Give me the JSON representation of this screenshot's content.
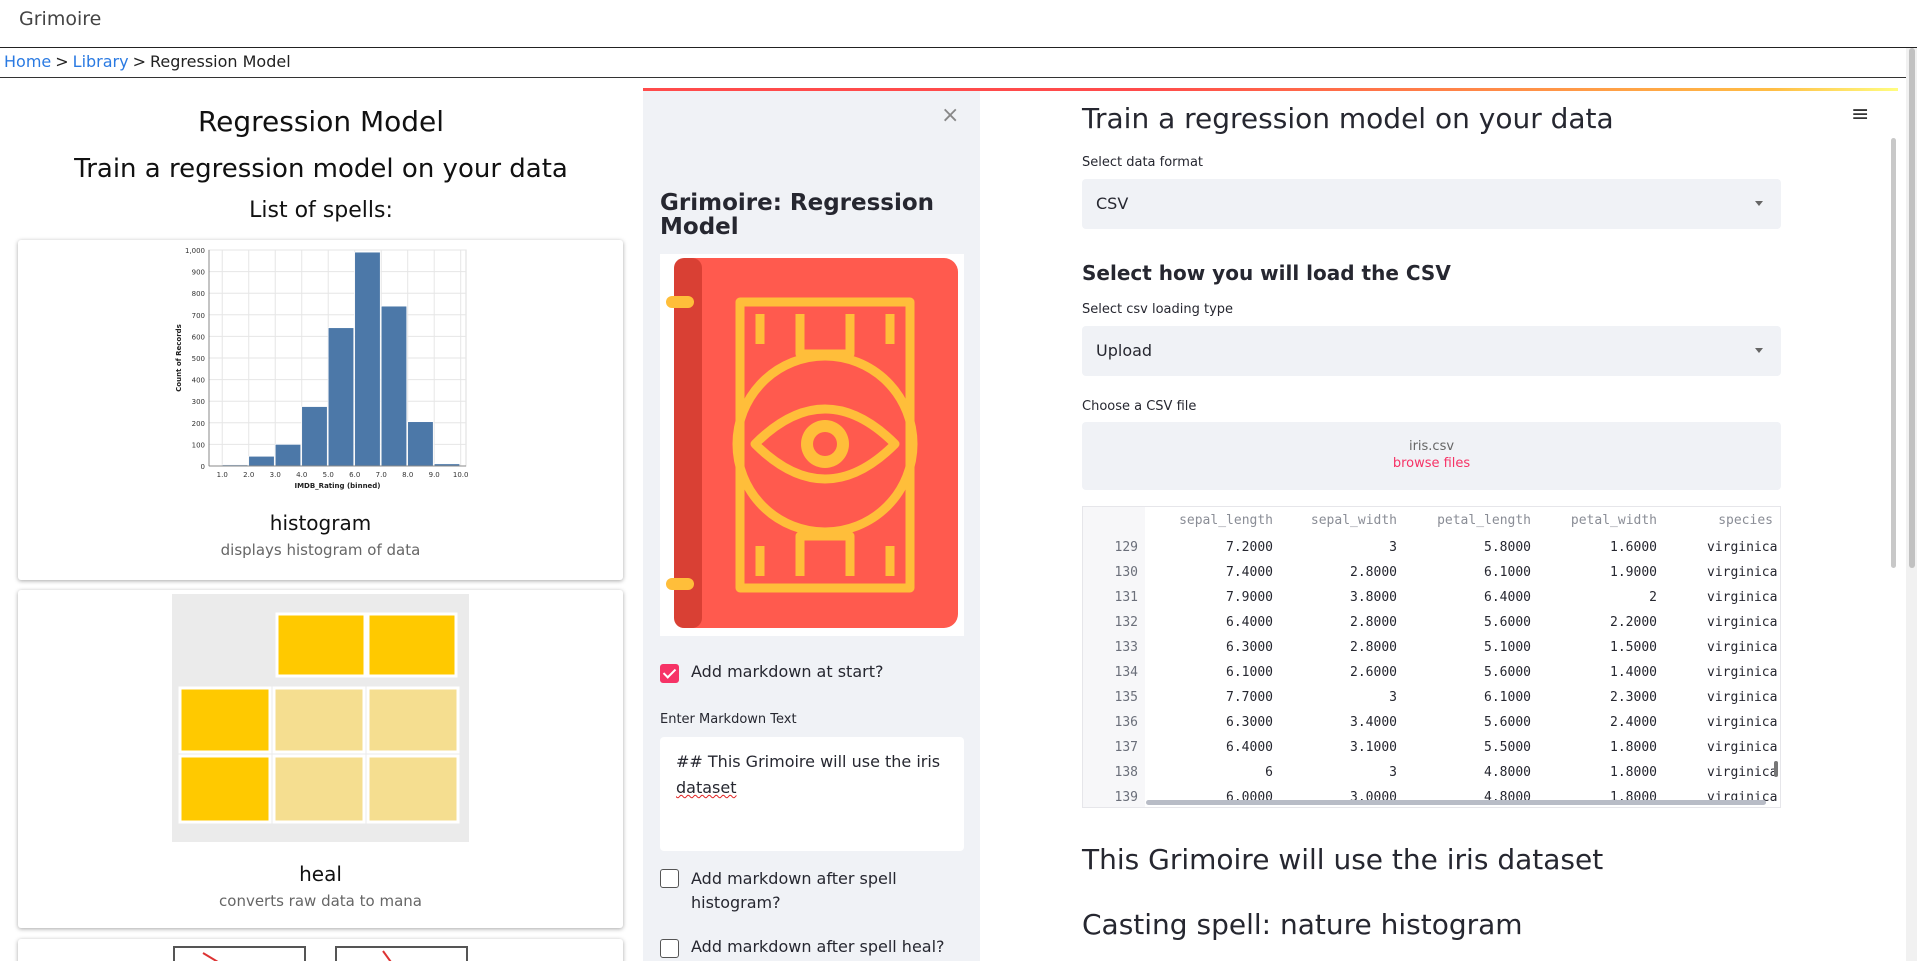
{
  "app": {
    "title": "Grimoire"
  },
  "breadcrumb": {
    "home": "Home",
    "library": "Library",
    "current": "Regression Model",
    "separator": ">"
  },
  "left": {
    "title": "Regression Model",
    "subtitle": "Train a regression model on your data",
    "list_heading": "List of spells:",
    "spells": [
      {
        "name": "histogram",
        "desc": "displays histogram of data"
      },
      {
        "name": "heal",
        "desc": "converts raw data to mana"
      }
    ]
  },
  "chart_data": {
    "type": "bar",
    "xlabel": "IMDB_Rating (binned)",
    "ylabel": "Count of Records",
    "x_ticks": [
      "1.0",
      "2.0",
      "3.0",
      "4.0",
      "5.0",
      "6.0",
      "7.0",
      "8.0",
      "9.0",
      "10.0"
    ],
    "y_ticks": [
      "0",
      "100",
      "200",
      "300",
      "400",
      "500",
      "600",
      "700",
      "800",
      "900",
      "1,000"
    ],
    "ylim": [
      0,
      1000
    ],
    "bins": [
      [
        1,
        2
      ],
      [
        2,
        3
      ],
      [
        3,
        4
      ],
      [
        4,
        5
      ],
      [
        5,
        6
      ],
      [
        6,
        7
      ],
      [
        7,
        8
      ],
      [
        8,
        9
      ],
      [
        9,
        10
      ]
    ],
    "values": [
      5,
      45,
      100,
      275,
      640,
      990,
      740,
      205,
      10
    ],
    "color": "#4c78a8"
  },
  "sidebar": {
    "close": "×",
    "title": "Grimoire: Regression Model",
    "add_start_label": "Add markdown at start?",
    "add_start_checked": true,
    "markdown_label": "Enter Markdown Text",
    "markdown_text_1": "## This Grimoire will use the iris",
    "markdown_text_2": "dataset",
    "after_histogram_label_1": "Add markdown after spell",
    "after_histogram_label_2": "histogram?",
    "after_heal_label": "Add markdown after spell heal?"
  },
  "main": {
    "title": "Train a regression model on your data",
    "menu_icon": "≡",
    "format_label": "Select data format",
    "format_value": "CSV",
    "load_heading": "Select how you will load the CSV",
    "loading_label": "Select csv loading type",
    "loading_value": "Upload",
    "file_label": "Choose a CSV file",
    "file_name": "iris.csv",
    "browse": "browse files",
    "columns": [
      "sepal_length",
      "sepal_width",
      "petal_length",
      "petal_width",
      "species"
    ],
    "rows": [
      [
        "129",
        "7.2000",
        "3",
        "5.8000",
        "1.6000",
        "virginica"
      ],
      [
        "130",
        "7.4000",
        "2.8000",
        "6.1000",
        "1.9000",
        "virginica"
      ],
      [
        "131",
        "7.9000",
        "3.8000",
        "6.4000",
        "2",
        "virginica"
      ],
      [
        "132",
        "6.4000",
        "2.8000",
        "5.6000",
        "2.2000",
        "virginica"
      ],
      [
        "133",
        "6.3000",
        "2.8000",
        "5.1000",
        "1.5000",
        "virginica"
      ],
      [
        "134",
        "6.1000",
        "2.6000",
        "5.6000",
        "1.4000",
        "virginica"
      ],
      [
        "135",
        "7.7000",
        "3",
        "6.1000",
        "2.3000",
        "virginica"
      ],
      [
        "136",
        "6.3000",
        "3.4000",
        "5.6000",
        "2.4000",
        "virginica"
      ],
      [
        "137",
        "6.4000",
        "3.1000",
        "5.5000",
        "1.8000",
        "virginica"
      ],
      [
        "138",
        "6",
        "3",
        "4.8000",
        "1.8000",
        "virginica"
      ],
      [
        "139",
        "6.0000",
        "3.0000",
        "4.8000",
        "1.8000",
        "virginica"
      ]
    ],
    "md_heading": "This Grimoire will use the iris dataset",
    "cast_heading": "Casting spell: nature histogram"
  }
}
